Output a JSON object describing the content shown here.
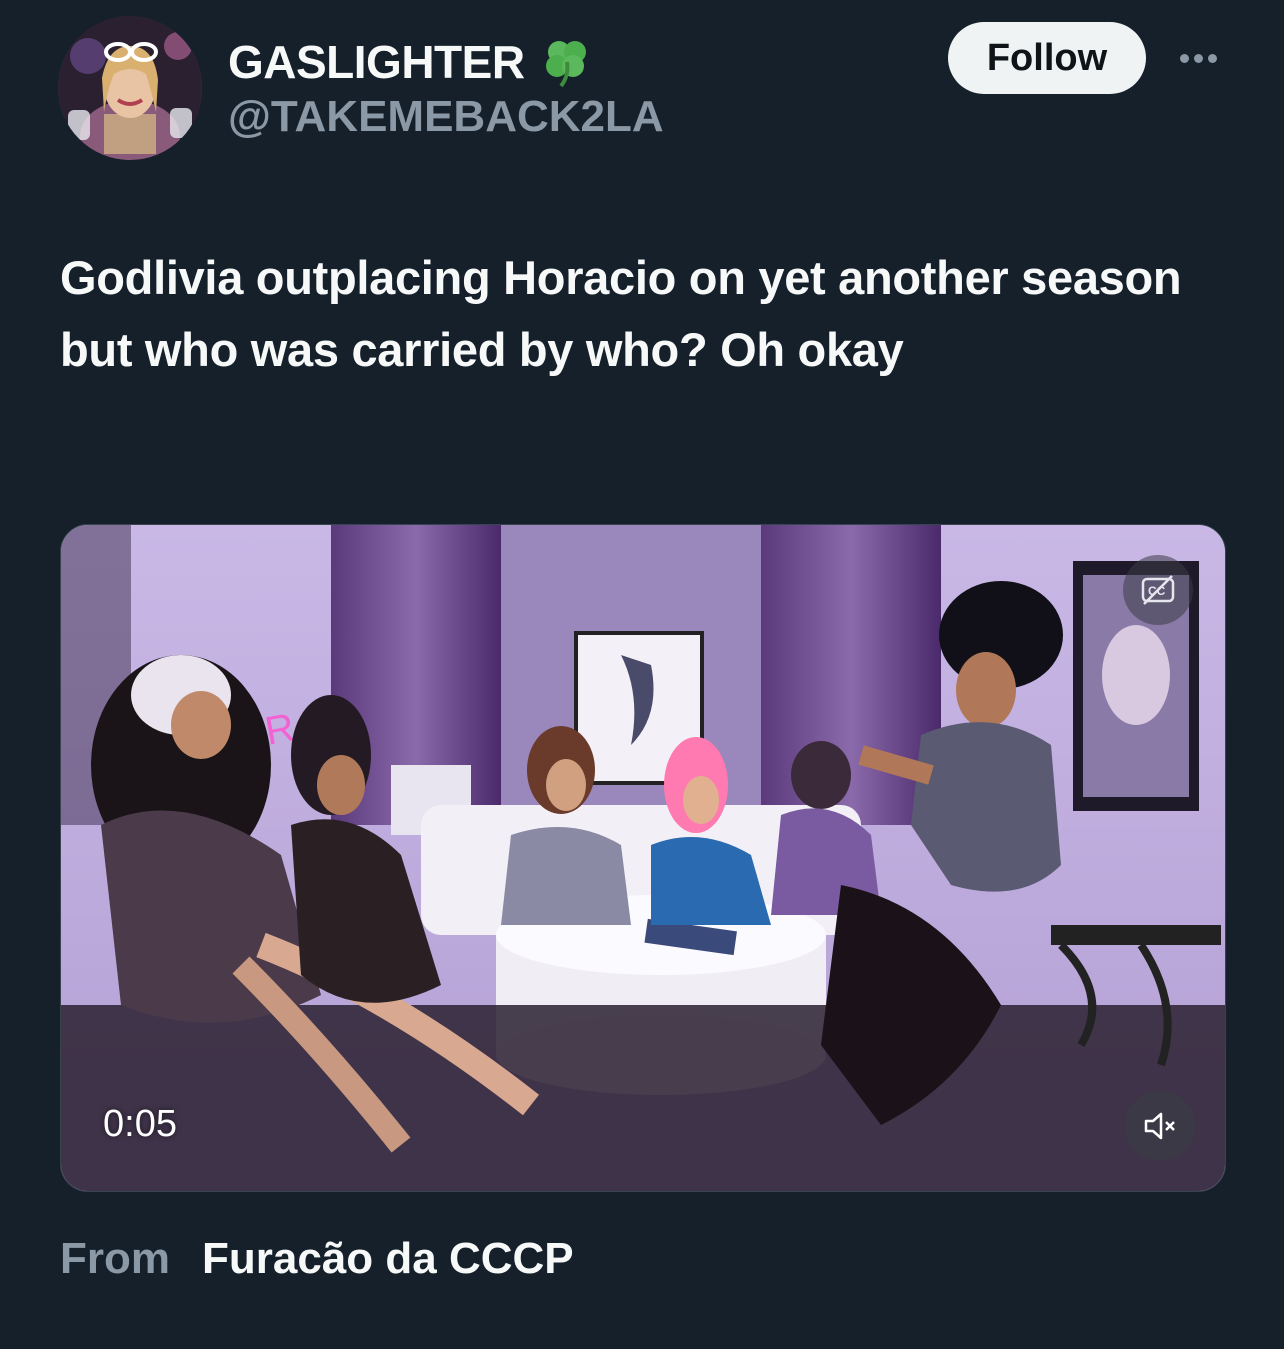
{
  "author": {
    "display_name": "GASLIGHTER",
    "handle": "@TAKEMEBACK2LA",
    "name_emoji": "four-leaf-clover-icon"
  },
  "actions": {
    "follow_label": "Follow",
    "more_icon": "more-icon"
  },
  "tweet": {
    "text": "Godlivia outplacing Horacio on yet another season but who was carried by who? Oh okay"
  },
  "media": {
    "type": "video",
    "duration": "0:05",
    "cc_icon": "captions-off-icon",
    "mute_icon": "muted-speaker-icon"
  },
  "attribution": {
    "from_label": "From",
    "source_name": "Furacão da CCCP"
  },
  "colors": {
    "background": "#15202b",
    "text_primary": "#f7f9f9",
    "text_secondary": "#8b98a5",
    "follow_button_bg": "#eff3f4"
  }
}
